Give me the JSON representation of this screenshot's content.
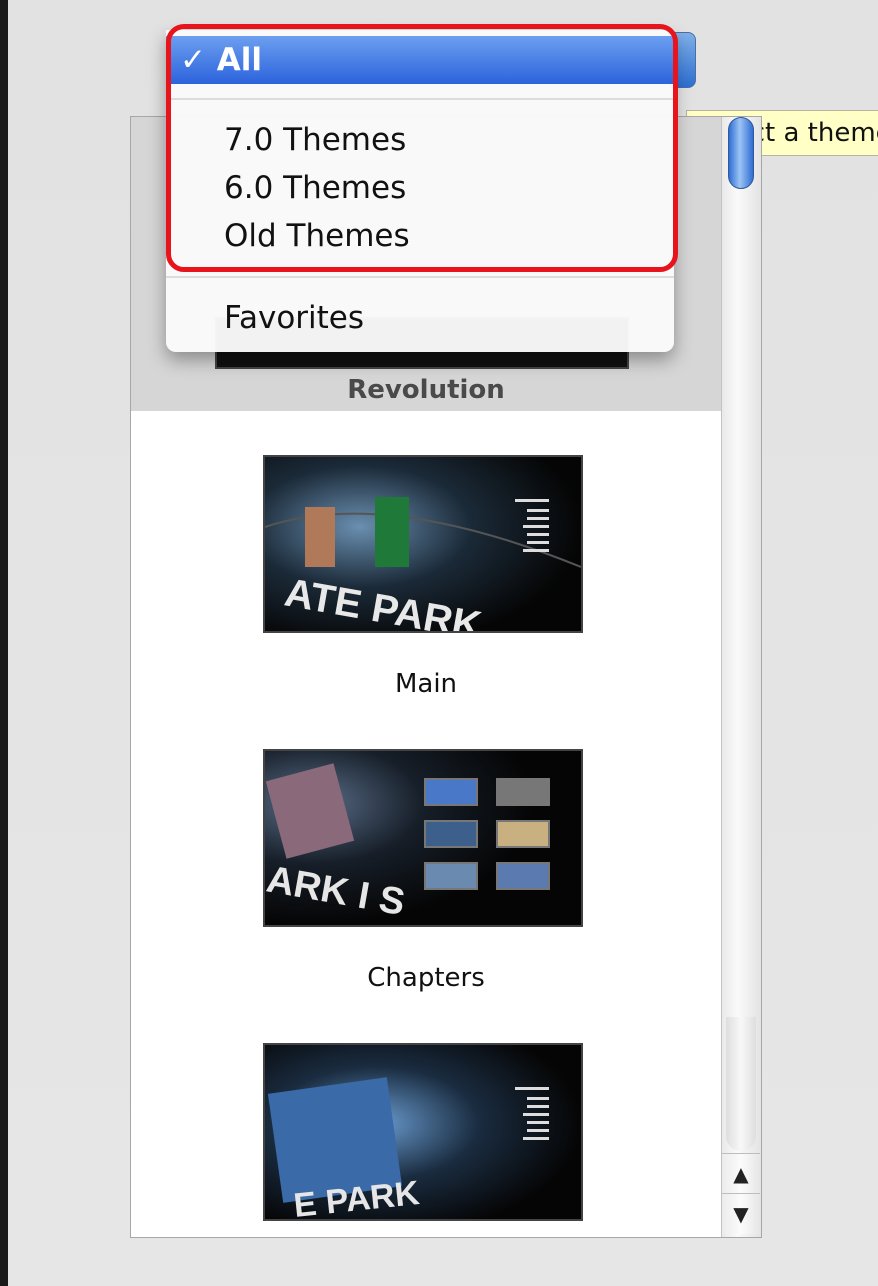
{
  "tooltip": {
    "text": "Select a theme"
  },
  "menu": {
    "check": "✓",
    "items": [
      {
        "label": "All",
        "checked": true
      },
      {
        "label": "7.0 Themes"
      },
      {
        "label": "6.0 Themes"
      },
      {
        "label": "Old Themes"
      },
      {
        "label": "Favorites"
      }
    ]
  },
  "themes": {
    "selected_name": "Revolution",
    "items": [
      {
        "label": "Main"
      },
      {
        "label": "Chapters"
      },
      {
        "label": ""
      }
    ],
    "thumb_text": {
      "main": "ATE PARK",
      "chapters": "ARK I S",
      "third": "E PARK"
    }
  },
  "scrollbar": {
    "up_arrow": "▲",
    "down_arrow": "▼"
  },
  "colors": {
    "highlight": "#e8141c",
    "selection": "#2c63dc",
    "tooltip_bg": "#ffffc6"
  }
}
